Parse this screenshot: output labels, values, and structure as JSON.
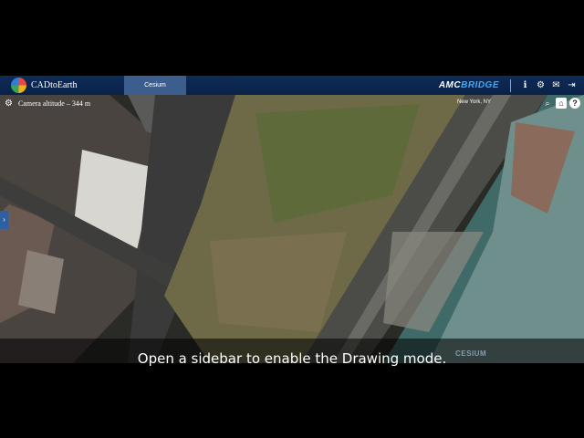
{
  "header": {
    "brand": "CADtoEarth",
    "tab": "Cesium",
    "partner_logo_a": "AMC",
    "partner_logo_b": "BRIDGE",
    "icons": [
      "info-icon",
      "settings-icon",
      "mail-icon",
      "logout-icon"
    ]
  },
  "map": {
    "altitude": "Camera altitude – 344 m",
    "location": "New York, NY",
    "credit": "CESIUM"
  },
  "video": {
    "caption": "Open a sidebar to enable the Drawing mode."
  },
  "colors": {
    "header": "#0d2b57",
    "tab_active": "#3b5e8f",
    "accent": "#3fa9f5"
  }
}
